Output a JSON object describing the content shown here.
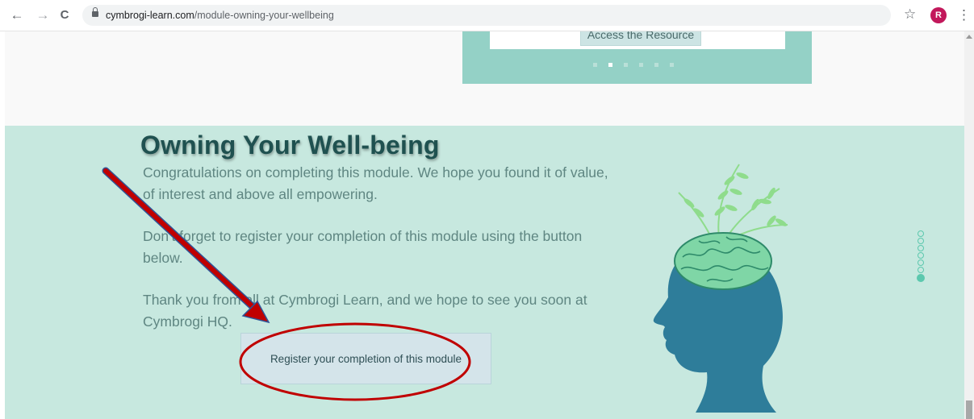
{
  "browser": {
    "back_icon": "←",
    "forward_icon": "→",
    "reload_icon": "C",
    "url_domain": "cymbrogi-learn.com",
    "url_path": "/module-owning-your-wellbeing",
    "star_icon": "☆",
    "profile_initial": "R",
    "menu_icon": "⋮"
  },
  "carousel": {
    "button_label": "Access the Resource",
    "active_dot": 1,
    "dot_count": 6
  },
  "module": {
    "title": "Owning Your Well-being",
    "paragraph_1": "Congratulations on completing this module. We hope you found it of value, of interest and above all empowering.",
    "paragraph_2": "Don't forget to register your completion of this module using the button below.",
    "paragraph_3": "Thank you from all at Cymbrogi Learn, and we hope to see you soon at Cymbrogi HQ.",
    "register_button": "Register your completion of this module"
  },
  "side_nav": {
    "dot_count": 7,
    "active_index": 6
  },
  "colors": {
    "section_bg": "#c7e8df",
    "carousel_bg": "#94d1c6",
    "title": "#1f5150",
    "annotation_red": "#c00000",
    "annotation_blue": "#2f5597",
    "side_nav": "#5cc8ae"
  }
}
